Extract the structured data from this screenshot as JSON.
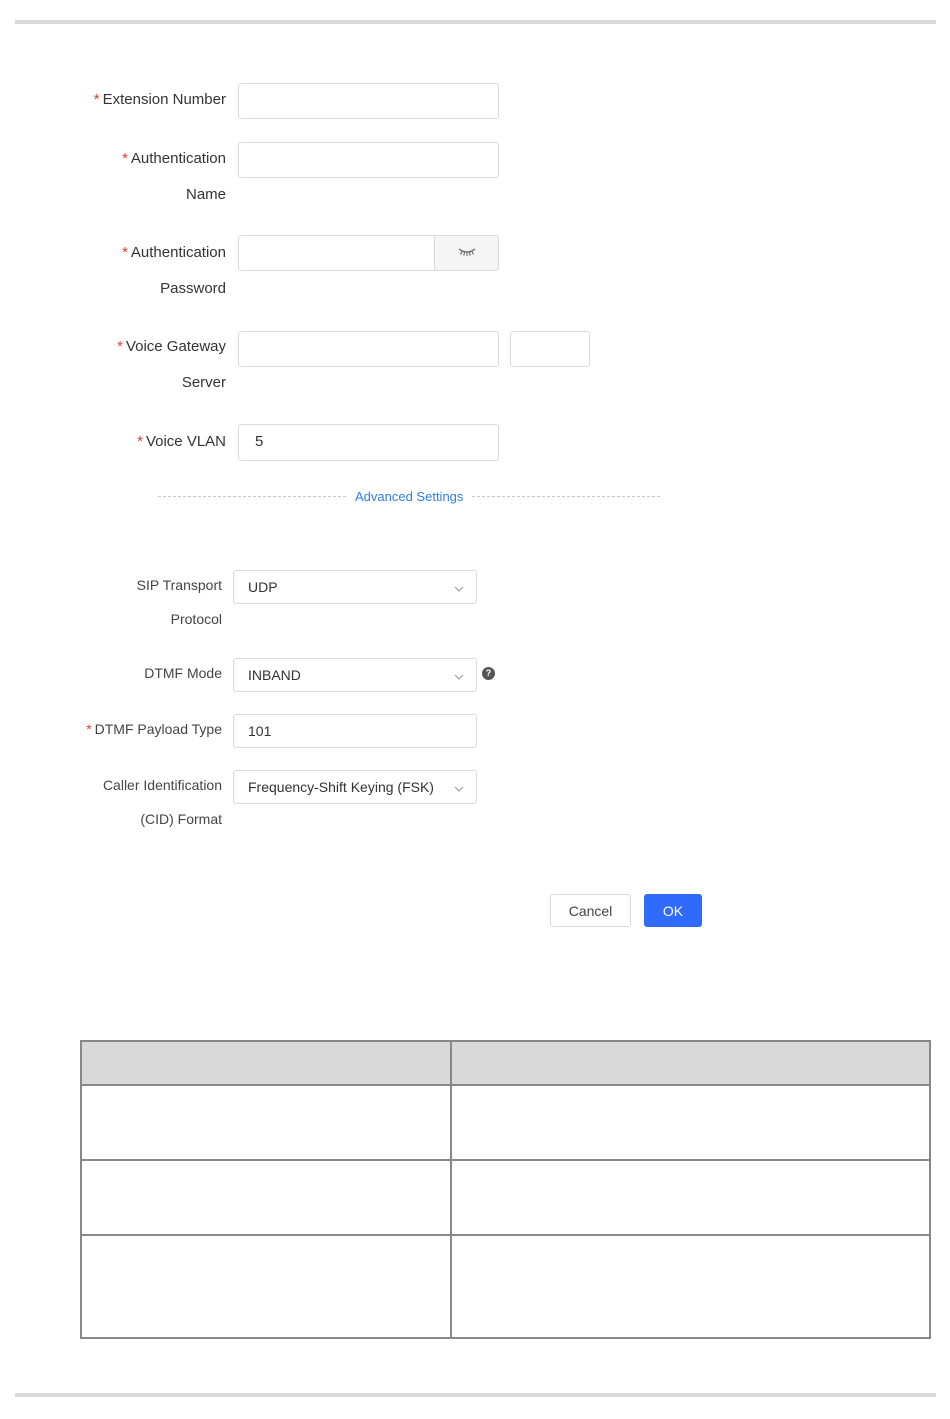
{
  "form": {
    "extension_number": {
      "label": "Extension Number",
      "value": ""
    },
    "auth_name": {
      "label_line1": "Authentication",
      "label_line2": "Name",
      "value": ""
    },
    "auth_password": {
      "label_line1": "Authentication",
      "label_line2": "Password",
      "value": ""
    },
    "voice_gateway": {
      "label_line1": "Voice Gateway",
      "label_line2": "Server",
      "address": "",
      "port": ""
    },
    "voice_vlan": {
      "label": "Voice VLAN",
      "value": "5"
    },
    "required_mark": "*"
  },
  "advanced": {
    "title": "Advanced Settings",
    "sip_transport": {
      "label_line1": "SIP Transport",
      "label_line2": "Protocol",
      "value": "UDP"
    },
    "dtmf_mode": {
      "label": "DTMF Mode",
      "value": "INBAND",
      "help": "?"
    },
    "dtmf_payload": {
      "label": "DTMF Payload Type",
      "value": "101"
    },
    "cid_format": {
      "label_line1": "Caller Identification",
      "label_line2": "(CID) Format",
      "value": "Frequency-Shift Keying (FSK)"
    }
  },
  "buttons": {
    "cancel": "Cancel",
    "ok": "OK"
  },
  "colors": {
    "accent": "#2f6bff",
    "link": "#2f7dea",
    "required": "#e53935"
  },
  "icons": {
    "password_toggle": "eye-closed-icon",
    "select": "chevron-down-icon",
    "help": "question-circle-icon"
  }
}
